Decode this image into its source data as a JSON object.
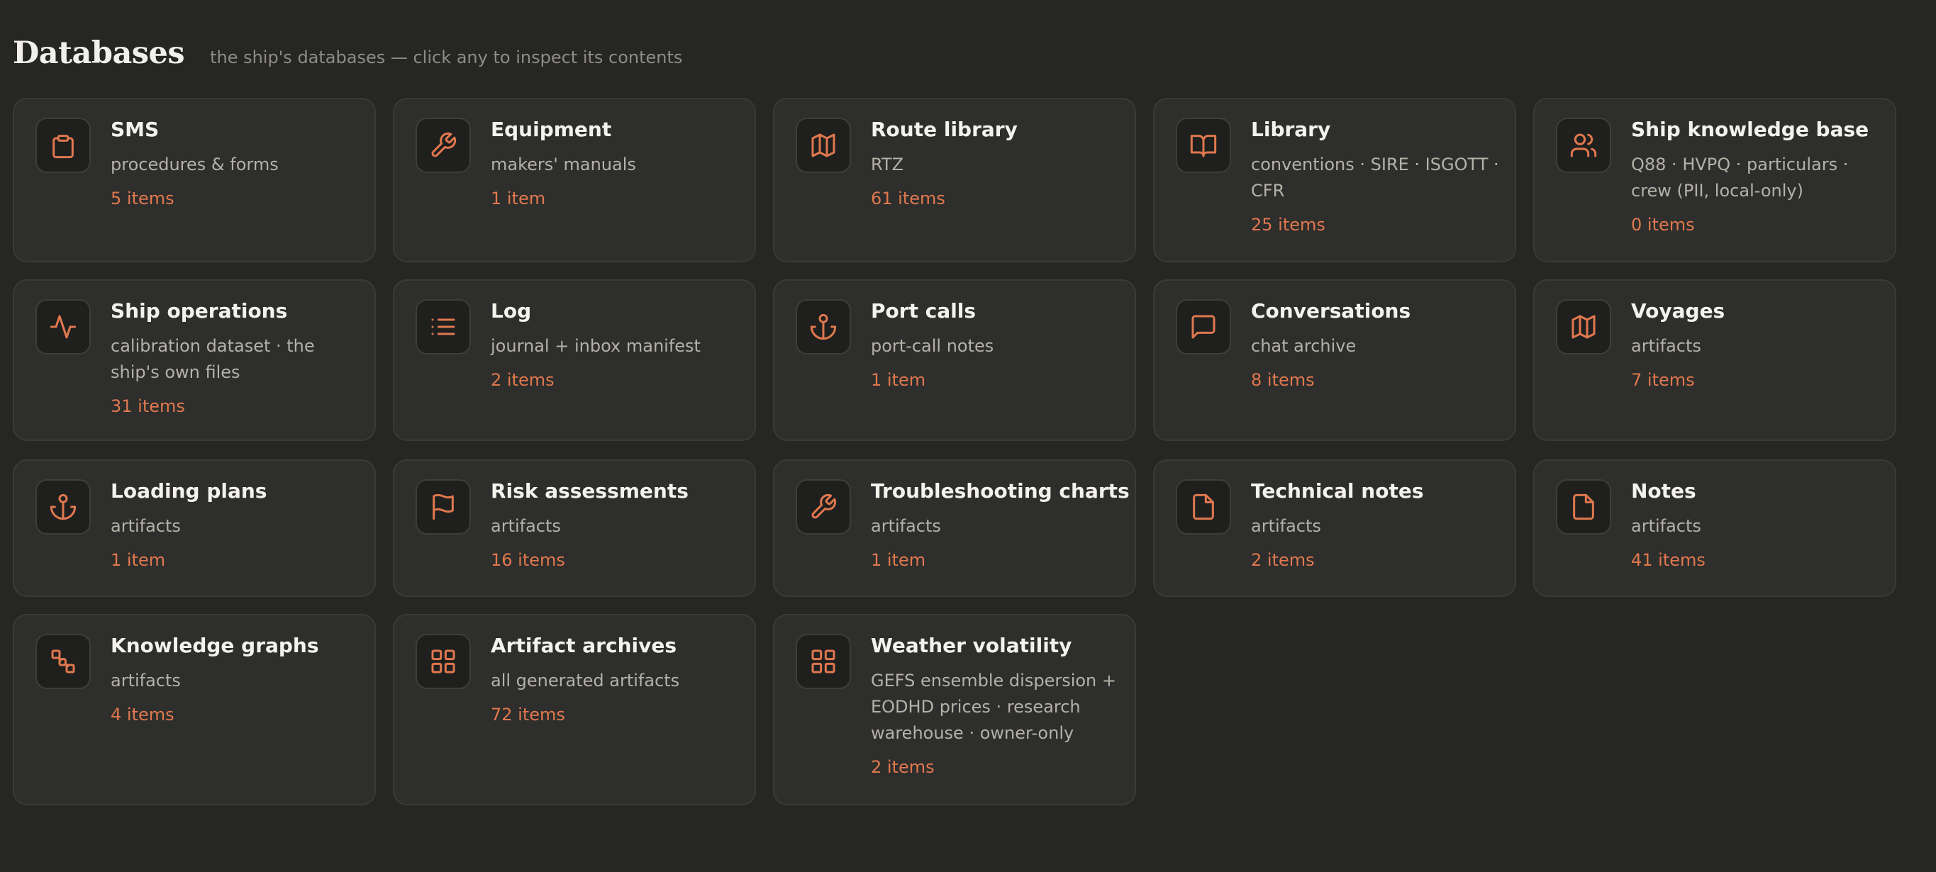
{
  "header": {
    "title": "Databases",
    "subtitle": "the ship's databases — click any to inspect its contents"
  },
  "theme": {
    "accent": "#e0784f",
    "background": "#262624",
    "card": "#2e2e2c"
  },
  "cards": [
    {
      "title": "SMS",
      "desc": "procedures & forms",
      "count": "5 items",
      "icon": "clipboard-icon"
    },
    {
      "title": "Equipment",
      "desc": "makers' manuals",
      "count": "1 item",
      "icon": "wrench-icon"
    },
    {
      "title": "Route library",
      "desc": "RTZ",
      "count": "61 items",
      "icon": "map-icon"
    },
    {
      "title": "Library",
      "desc": "conventions · SIRE · ISGOTT · CFR",
      "count": "25 items",
      "icon": "book-open-icon"
    },
    {
      "title": "Ship knowledge base",
      "desc": "Q88 · HVPQ · particulars · crew (PII, local-only)",
      "count": "0 items",
      "icon": "users-icon"
    },
    {
      "title": "Ship operations",
      "desc": "calibration dataset · the ship's own files",
      "count": "31 items",
      "icon": "activity-icon"
    },
    {
      "title": "Log",
      "desc": "journal + inbox manifest",
      "count": "2 items",
      "icon": "list-icon"
    },
    {
      "title": "Port calls",
      "desc": "port-call notes",
      "count": "1 item",
      "icon": "anchor-icon"
    },
    {
      "title": "Conversations",
      "desc": "chat archive",
      "count": "8 items",
      "icon": "message-square-icon"
    },
    {
      "title": "Voyages",
      "desc": "artifacts",
      "count": "7 items",
      "icon": "map-icon"
    },
    {
      "title": "Loading plans",
      "desc": "artifacts",
      "count": "1 item",
      "icon": "anchor-icon"
    },
    {
      "title": "Risk assessments",
      "desc": "artifacts",
      "count": "16 items",
      "icon": "flag-icon"
    },
    {
      "title": "Troubleshooting charts",
      "desc": "artifacts",
      "count": "1 item",
      "icon": "wrench-icon"
    },
    {
      "title": "Technical notes",
      "desc": "artifacts",
      "count": "2 items",
      "icon": "file-icon"
    },
    {
      "title": "Notes",
      "desc": "artifacts",
      "count": "41 items",
      "icon": "file-icon"
    },
    {
      "title": "Knowledge graphs",
      "desc": "artifacts",
      "count": "4 items",
      "icon": "graph-nodes-icon"
    },
    {
      "title": "Artifact archives",
      "desc": "all generated artifacts",
      "count": "72 items",
      "icon": "grid-icon"
    },
    {
      "title": "Weather volatility",
      "desc": "GEFS ensemble dispersion + EODHD prices · research warehouse · owner-only",
      "count": "2 items",
      "icon": "grid-icon"
    }
  ]
}
